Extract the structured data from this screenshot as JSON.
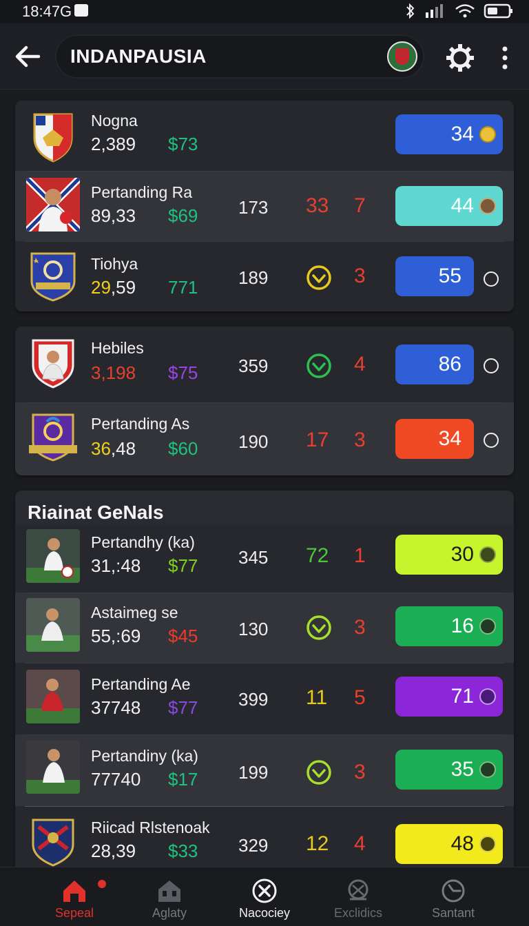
{
  "status_bar": {
    "time": "18:47G"
  },
  "header": {
    "title": "INDANPAUSIA"
  },
  "cards": [
    {
      "rows": [
        {
          "name": "Nogna",
          "num": "2,389",
          "price": "$73",
          "price_color": "#1fc17f",
          "stat_a": "",
          "stat_b": "",
          "stat_c": "",
          "score": "34",
          "score_color": "#2f5fd6",
          "coin": "gold"
        },
        {
          "name": "Pertanding Ra",
          "num": "89,33",
          "price": "$69",
          "price_color": "#1fc17f",
          "stat_a": "173",
          "stat_b": "33",
          "stat_c": "7",
          "score": "44",
          "score_color": "#5ed8d0",
          "coin": "bronze"
        },
        {
          "name": "Tiohya",
          "num_yellow": "29",
          "num_rest": ",59",
          "price": "771",
          "price_color": "#1fc17f",
          "stat_a": "189",
          "stat_b": "",
          "stat_c": "3",
          "score": "55",
          "score_color": "#2f5fd6"
        }
      ]
    },
    {
      "rows": [
        {
          "name": "Hebiles",
          "num": "3,198",
          "price": "$75",
          "price_color": "#9a43e6",
          "stat_a": "359",
          "stat_c": "4",
          "score": "86",
          "score_color": "#2f5fd6"
        },
        {
          "name": "Pertanding As",
          "num_yellow": "36",
          "num_rest": ",48",
          "price": "$60",
          "price_color": "#1fc17f",
          "stat_a": "190",
          "stat_b": "17",
          "stat_c": "3",
          "score": "34",
          "score_color": "#f04a25"
        }
      ]
    },
    {
      "section_title": "Riainat GeNals",
      "rows": [
        {
          "name": "Pertandhy (ka)",
          "num": "31,:48",
          "price": "$77",
          "price_color": "#7fd021",
          "stat_a": "345",
          "stat_b": "72",
          "stat_c": "1",
          "score": "30",
          "score_color": "#c6f52d"
        },
        {
          "name": "Astaimeg se",
          "num": "55,:69",
          "price": "$45",
          "price_color": "#ee3a2c",
          "stat_a": "130",
          "stat_c": "3",
          "score": "16",
          "score_color": "#1cae55"
        },
        {
          "name": "Pertanding Ae",
          "num": "37748",
          "price": "$77",
          "price_color": "#8a48e4",
          "stat_a": "399",
          "stat_b": "11",
          "stat_c": "5",
          "score": "71",
          "score_color": "#8b26d9"
        },
        {
          "name": "Pertandiny (ka)",
          "num": "77740",
          "price": "$17",
          "price_color": "#1fc17f",
          "stat_a": "199",
          "stat_c": "3",
          "score": "35",
          "score_color": "#1cae55"
        },
        {
          "name": "Riicad Rlstenoak",
          "num": "28,39",
          "price": "$33",
          "price_color": "#1fc17f",
          "stat_a": "329",
          "stat_b": "12",
          "stat_c": "4",
          "score": "48",
          "score_color": "#f2ea1d"
        }
      ]
    }
  ],
  "bottom_nav": [
    {
      "label": "Sepeal",
      "icon": "home-icon",
      "active": true
    },
    {
      "label": "Aglaty",
      "icon": "building-icon"
    },
    {
      "label": "Nacociey",
      "icon": "close-circle-icon"
    },
    {
      "label": "Exclidics",
      "icon": "search-icon"
    },
    {
      "label": "Santant",
      "icon": "clock-icon"
    }
  ]
}
